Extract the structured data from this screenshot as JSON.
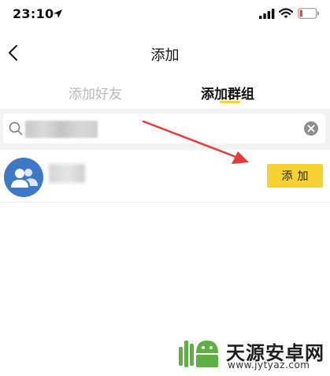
{
  "status_bar": {
    "time": "23:10",
    "icons": [
      "location-arrow-icon",
      "cellular-signal-icon",
      "wifi-icon",
      "battery-low-icon"
    ],
    "battery_color": "#e24a4a"
  },
  "nav": {
    "title": "添加",
    "back_icon": "chevron-left-icon"
  },
  "tabs": {
    "items": [
      {
        "label": "添加好友",
        "active": false
      },
      {
        "label": "添加群组",
        "active": true
      }
    ],
    "active_underline_color": "#f5d13a"
  },
  "search": {
    "value": "",
    "value_obscured": true,
    "icon": "search-icon",
    "clear_icon": "clear-circle-icon"
  },
  "results": [
    {
      "avatar_icon": "group-avatar-icon",
      "name": "",
      "name_obscured": true,
      "button_label": "添加",
      "button_color": "#f6d231"
    }
  ],
  "annotation": {
    "type": "red-arrow",
    "color": "#e83a3a",
    "points_to": "add-button"
  },
  "watermark": {
    "text": "天源安卓网",
    "url": "www.jytyaz.com",
    "logo_color": "#5fb043"
  }
}
